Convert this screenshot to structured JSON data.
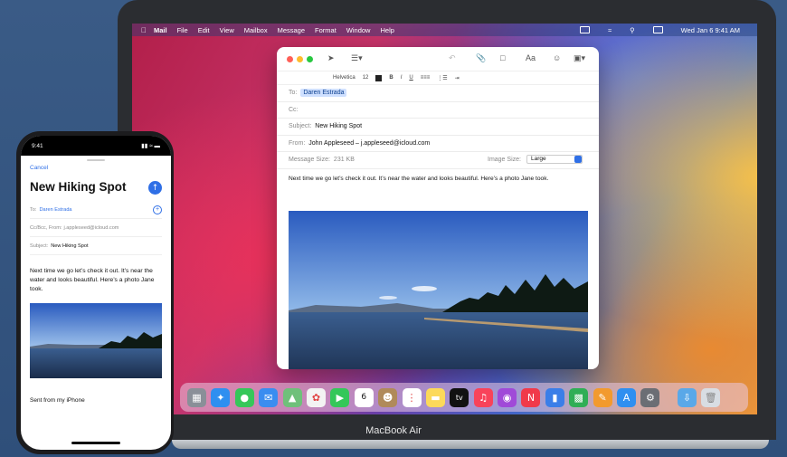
{
  "mac": {
    "menubar": {
      "app": "Mail",
      "items": [
        "File",
        "Edit",
        "View",
        "Mailbox",
        "Message",
        "Format",
        "Window",
        "Help"
      ],
      "clock": "Wed Jan 6  9:41 AM"
    },
    "compose": {
      "format": {
        "font": "Helvetica",
        "size": "12"
      },
      "to_label": "To:",
      "to_value": "Daren Estrada",
      "cc_label": "Cc:",
      "subject_label": "Subject:",
      "subject_value": "New Hiking Spot",
      "from_label": "From:",
      "from_value": "John Appleseed – j.appleseed@icloud.com",
      "msg_size_label": "Message Size:",
      "msg_size_value": "231 KB",
      "image_size_label": "Image Size:",
      "image_size_value": "Large",
      "body": "Next time we go let’s check it out. It’s near the water and looks beautiful. Here’s a photo Jane took."
    },
    "dock_apps": [
      "Launchpad",
      "Safari",
      "Messages",
      "Mail",
      "Maps",
      "Photos",
      "FaceTime",
      "Calendar",
      "Contacts",
      "Reminders",
      "Notes",
      "TV",
      "Music",
      "Podcasts",
      "News",
      "Keynote",
      "Numbers",
      "Pages",
      "App Store",
      "System Preferences",
      "Downloads",
      "Trash"
    ],
    "calendar_day": "6",
    "brand": "MacBook Air"
  },
  "phone": {
    "time": "9:41",
    "cancel": "Cancel",
    "title": "New Hiking Spot",
    "to_label": "To:",
    "to_value": "Daren Estrada",
    "from_label": "Cc/Bcc, From:",
    "from_value": "j.appleseed@icloud.com",
    "subject_label": "Subject:",
    "subject_value": "New Hiking Spot",
    "body": "Next time we go let’s check it out. It’s near the water and looks beautiful. Here’s a photo Jane took.",
    "signature": "Sent from my iPhone"
  },
  "colors": {
    "accent": "#2f6fe6",
    "lid": "#2b2d31"
  }
}
